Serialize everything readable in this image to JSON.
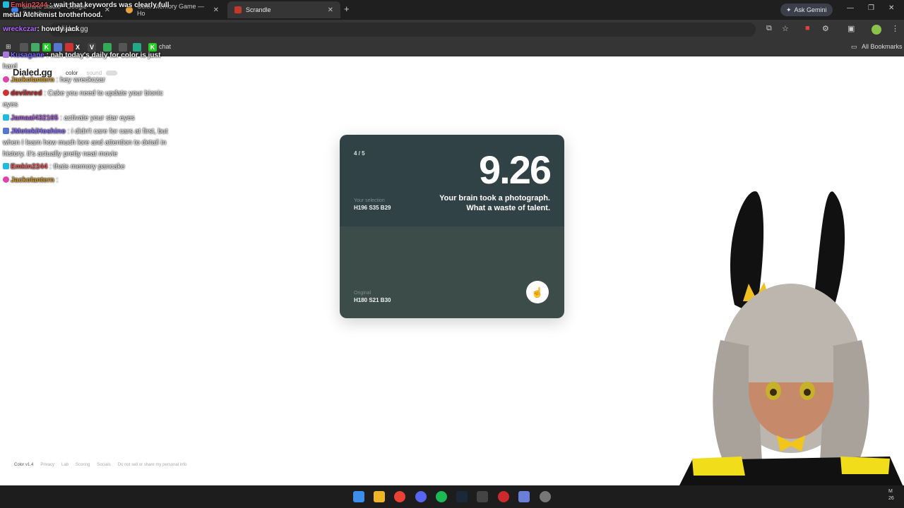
{
  "browser": {
    "tabs": [
      {
        "title": "akrane studio - Google Search",
        "color": "#4285f4"
      },
      {
        "title": "Color Memory Game — Ho",
        "color": "#e8a33a"
      },
      {
        "title": "Scrandle",
        "color": "#c0392b"
      }
    ],
    "new_tab": "+",
    "ask_gemini": "Ask Gemini",
    "url": "dialed.gg",
    "all_bookmarks": "All Bookmarks",
    "bookmark_chat": "chat"
  },
  "page": {
    "brand": "Dialed.gg",
    "mode_color": "color",
    "mode_sound": "sound"
  },
  "card": {
    "round": "4 / 5",
    "score": "9.26",
    "message_line1": "Your brain took a photograph.",
    "message_line2": "What a waste of talent.",
    "selection_label": "Your selection",
    "selection_value": "H196 S35 B29",
    "original_label": "Original",
    "original_value": "H180 S21 B30",
    "selection_color": "#314247",
    "original_color": "#3b4c49"
  },
  "footer": {
    "version": "Color v1.4",
    "links": [
      "Privacy",
      "Lab",
      "Scoring",
      "Socials",
      "Do not sell or share my personal info"
    ]
  },
  "chat": [
    {
      "user": "Emkin2244",
      "color": "#e05050",
      "text": ": wait that keywords was clearly full"
    },
    {
      "user": "",
      "color": "#ffffff",
      "text": "metal Alchemist brotherhood."
    },
    {
      "user": "wreckczar",
      "color": "#b36bff",
      "text": ": howdy jack"
    },
    {
      "user": "Kusagane",
      "color": "#7a6bff",
      "text": ": nah today's daily for color is just"
    },
    {
      "user": "",
      "color": "#ffffff",
      "text": "hard"
    },
    {
      "user": "Jackolantern",
      "color": "#d49a2a",
      "text": ": hey wreckczar"
    },
    {
      "user": "devilnred",
      "color": "#c22a2a",
      "text": ": Cake you need to update your bionic"
    },
    {
      "user": "",
      "color": "#ffffff",
      "text": "eyes"
    },
    {
      "user": "Jamaal432165",
      "color": "#a35bd6",
      "text": ": activate your star eyes"
    },
    {
      "user": "JMotokiHoshino",
      "color": "#8a6bff",
      "text": ": i didn't care for cars at first, but"
    },
    {
      "user": "",
      "color": "#ffffff",
      "text": "when I learn how much lore and attention to detail in"
    },
    {
      "user": "",
      "color": "#ffffff",
      "text": "history. it's actually pretty neat movie"
    },
    {
      "user": "Emkin2244",
      "color": "#e05050",
      "text": ": thats memory pancake"
    },
    {
      "user": "Jackolantern",
      "color": "#d49a2a",
      "text": ":"
    }
  ],
  "clock": {
    "line1": "M",
    "line2": "26"
  }
}
